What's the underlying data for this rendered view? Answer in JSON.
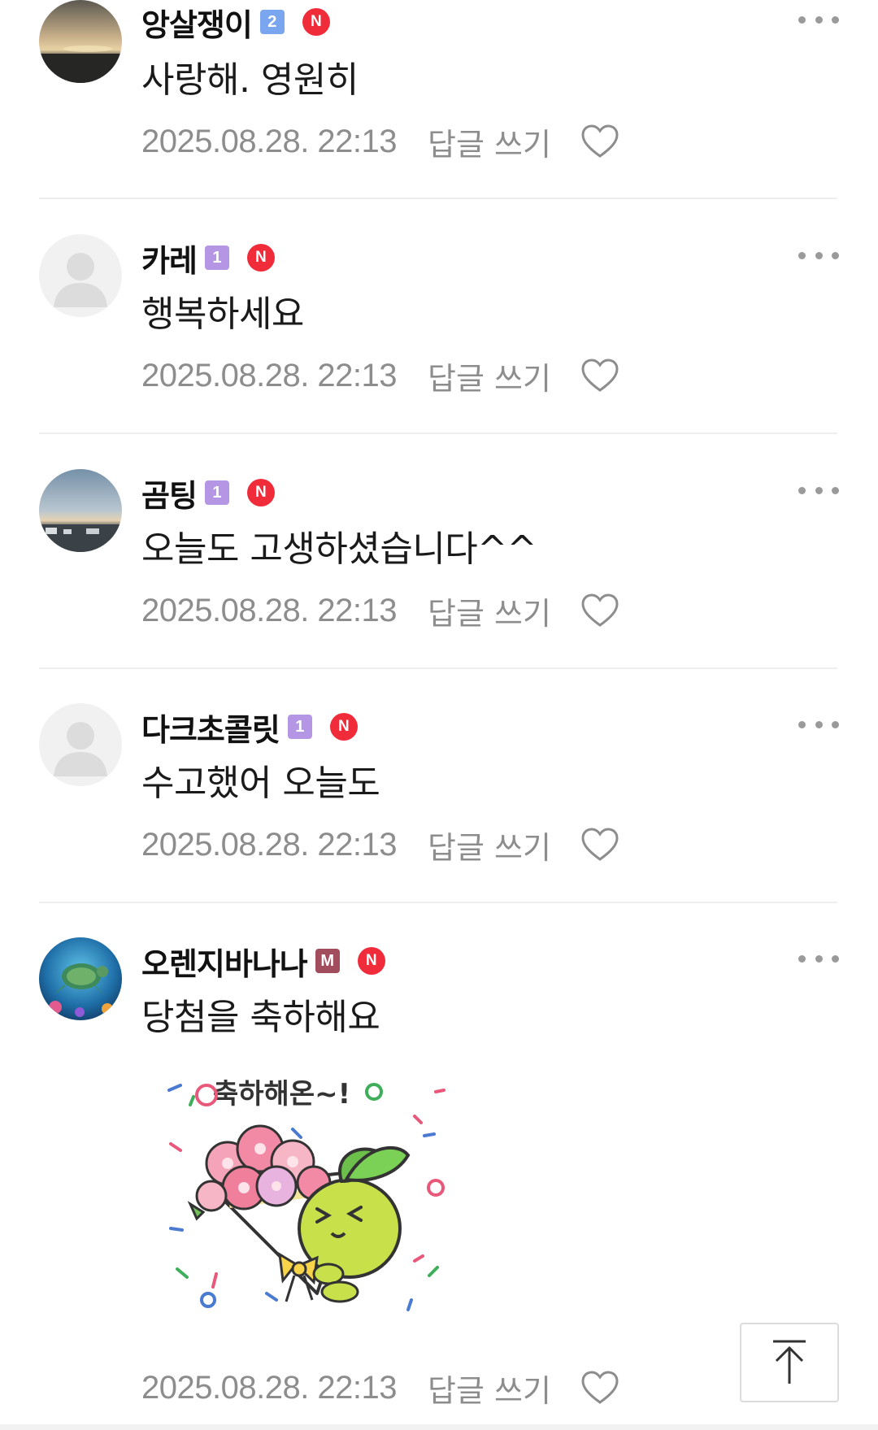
{
  "comments": [
    {
      "nickname": "앙살쟁이",
      "level": "2",
      "level_color": "#79a6ee",
      "new_badge": "N",
      "text": "사랑해. 영원히",
      "date": "2025.08.28. 22:13",
      "reply_label": "답글 쓰기",
      "avatar": "sunset-sea-photo"
    },
    {
      "nickname": "카레",
      "level": "1",
      "level_color": "#b596e4",
      "new_badge": "N",
      "text": "행복하세요",
      "date": "2025.08.28. 22:13",
      "reply_label": "답글 쓰기",
      "avatar": "default-profile"
    },
    {
      "nickname": "곰팅",
      "level": "1",
      "level_color": "#b596e4",
      "new_badge": "N",
      "text": "오늘도 고생하셨습니다^^",
      "date": "2025.08.28. 22:13",
      "reply_label": "답글 쓰기",
      "avatar": "dusk-sky-photo"
    },
    {
      "nickname": "다크초콜릿",
      "level": "1",
      "level_color": "#b596e4",
      "new_badge": "N",
      "text": "수고했어 오늘도",
      "date": "2025.08.28. 22:13",
      "reply_label": "답글 쓰기",
      "avatar": "default-profile"
    },
    {
      "nickname": "오렌지바나나",
      "level": "M",
      "level_color": "#a14d5e",
      "new_badge": "N",
      "text": "당첨을 축하해요",
      "sticker_text": "축하해온~!",
      "date": "2025.08.28. 22:13",
      "reply_label": "답글 쓰기",
      "avatar": "sea-turtle-photo"
    }
  ],
  "icons": {
    "more": "more-dots-icon",
    "like": "heart-icon",
    "scroll_top": "arrow-up-icon"
  },
  "colors": {
    "new_badge": "#f02b3a",
    "meta_text": "#8d8d8d",
    "divider": "#eeeeee"
  }
}
